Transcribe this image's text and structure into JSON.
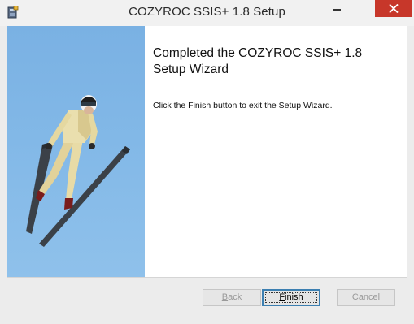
{
  "window": {
    "title": "COZYROC SSIS+ 1.8 Setup",
    "icon": "installer-icon",
    "close_color": "#c7372a"
  },
  "wizard": {
    "heading": "Completed the COZYROC SSIS+ 1.8 Setup Wizard",
    "body": "Click the Finish button to exit the Setup Wizard.",
    "banner_image": "ski-jumper-image"
  },
  "buttons": {
    "back": {
      "mnemonic": "B",
      "rest": "ack",
      "enabled": false
    },
    "finish": {
      "mnemonic": "F",
      "rest": "inish",
      "enabled": true
    },
    "cancel": {
      "label": "Cancel",
      "enabled": false
    }
  }
}
